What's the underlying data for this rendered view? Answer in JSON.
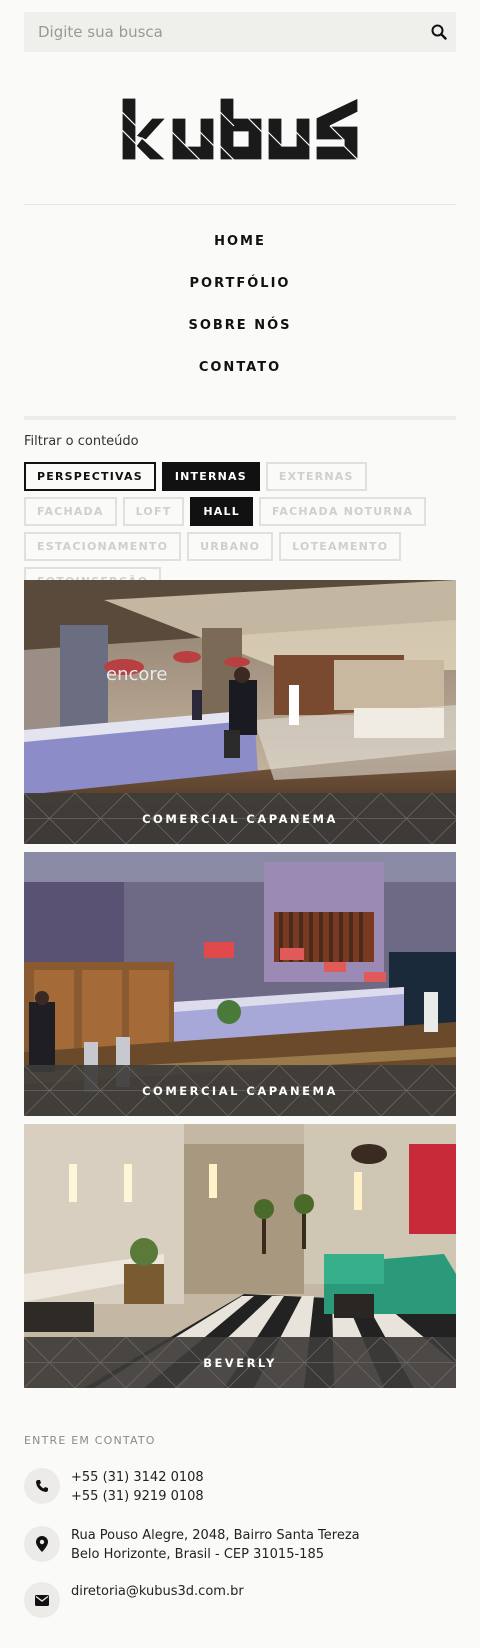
{
  "search": {
    "placeholder": "Digite sua busca",
    "icon": "search-icon"
  },
  "logo": {
    "text": "kubus"
  },
  "nav": {
    "items": [
      "HOME",
      "PORTFÓLIO",
      "SOBRE NÓS",
      "CONTATO"
    ]
  },
  "filter": {
    "label": "Filtrar o conteúdo",
    "tags": [
      {
        "label": "PERSPECTIVAS",
        "state": "outline"
      },
      {
        "label": "INTERNAS",
        "state": "active"
      },
      {
        "label": "EXTERNAS",
        "state": "inactive"
      },
      {
        "label": "FACHADA",
        "state": "inactive"
      },
      {
        "label": "LOFT",
        "state": "inactive"
      },
      {
        "label": "HALL",
        "state": "active"
      },
      {
        "label": "FACHADA NOTURNA",
        "state": "inactive"
      },
      {
        "label": "ESTACIONAMENTO",
        "state": "inactive"
      },
      {
        "label": "URBANO",
        "state": "inactive"
      },
      {
        "label": "LOTEAMENTO",
        "state": "inactive"
      },
      {
        "label": "FOTOINSERÇÃO",
        "state": "inactive"
      }
    ]
  },
  "portfolio": [
    {
      "title": "COMERCIAL CAPANEMA",
      "sign": "encore"
    },
    {
      "title": "COMERCIAL CAPANEMA"
    },
    {
      "title": "BEVERLY"
    }
  ],
  "contact": {
    "title": "ENTRE EM CONTATO",
    "phone1": "+55 (31) 3142 0108",
    "phone2": "+55 (31) 9219 0108",
    "address1": "Rua Pouso Alegre, 2048, Bairro Santa Tereza",
    "address2": "Belo Horizonte, Brasil - CEP 31015-185",
    "email": "diretoria@kubus3d.com.br"
  },
  "colors": {
    "accent": "#111111",
    "caption_bg": "#3e3c3a",
    "page_bg": "#fafaf8",
    "inactive_tag": "#cfcfcc"
  }
}
